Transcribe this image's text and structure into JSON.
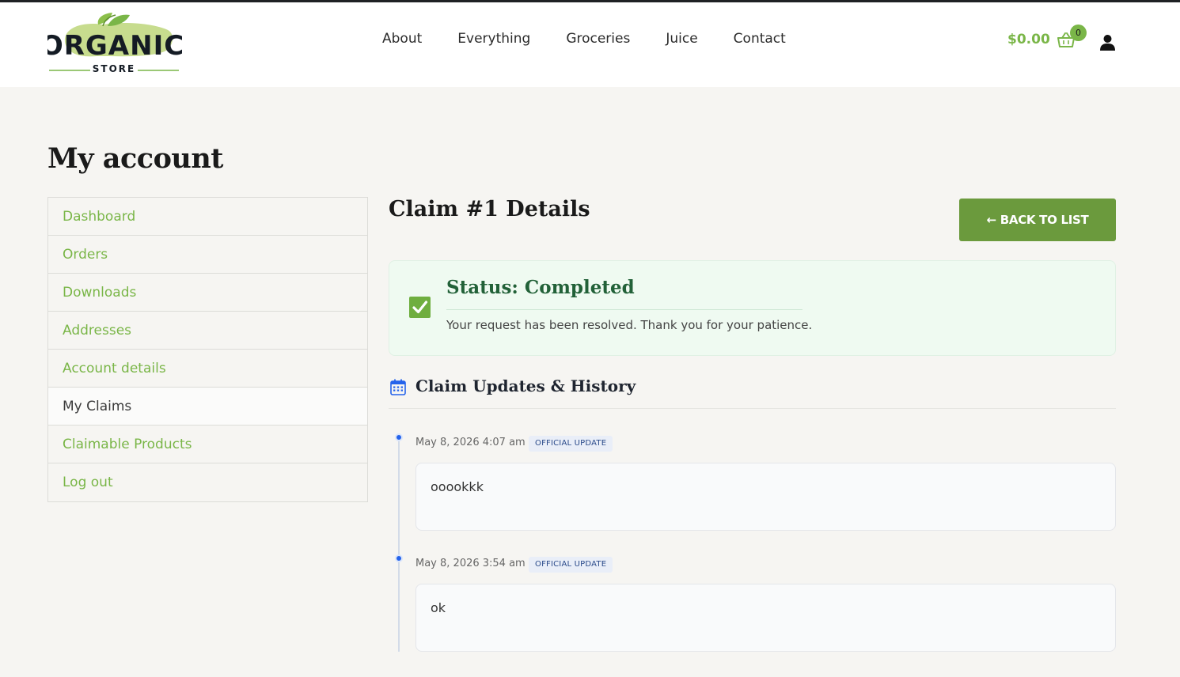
{
  "brand": {
    "logo_line1": "ORGANIC",
    "logo_line2": "STORE"
  },
  "nav": [
    "About",
    "Everything",
    "Groceries",
    "Juice",
    "Contact"
  ],
  "cart": {
    "total": "$0.00",
    "count": "0"
  },
  "page": {
    "title": "My account"
  },
  "account_nav": [
    {
      "label": "Dashboard",
      "active": false
    },
    {
      "label": "Orders",
      "active": false
    },
    {
      "label": "Downloads",
      "active": false
    },
    {
      "label": "Addresses",
      "active": false
    },
    {
      "label": "Account details",
      "active": false
    },
    {
      "label": "My Claims",
      "active": true
    },
    {
      "label": "Claimable Products",
      "active": false
    },
    {
      "label": "Log out",
      "active": false
    }
  ],
  "claim": {
    "title": "Claim #1 Details",
    "back_label": "← BACK TO LIST",
    "status_title": "Status: Completed",
    "status_message": "Your request has been resolved. Thank you for your patience.",
    "history_title": "Claim Updates & History",
    "updates": [
      {
        "date": "May 8, 2026 4:07 am",
        "badge": "OFFICIAL UPDATE",
        "message": "ooookkk"
      },
      {
        "date": "May 8, 2026 3:54 am",
        "badge": "OFFICIAL UPDATE",
        "message": "ok"
      }
    ]
  },
  "colors": {
    "accent": "#7ab648",
    "button": "#6b9a3d",
    "status_green": "#226138",
    "timeline_blue": "#2563eb"
  }
}
